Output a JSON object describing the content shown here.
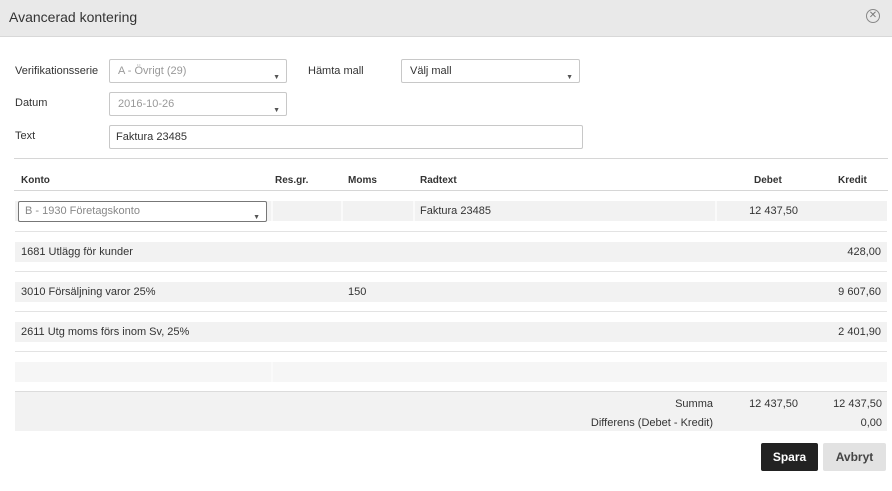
{
  "dialog": {
    "title": "Avancerad kontering",
    "close_icon": "close-circle-icon"
  },
  "form": {
    "series_label": "Verifikationsserie",
    "series_value": "A - Övrigt (29)",
    "template_label": "Hämta mall",
    "template_value": "Välj mall",
    "date_label": "Datum",
    "date_value": "2016-10-26",
    "text_label": "Text",
    "text_value": "Faktura 23485"
  },
  "table": {
    "headers": {
      "konto": "Konto",
      "resgr": "Res.gr.",
      "moms": "Moms",
      "radtext": "Radtext",
      "debet": "Debet",
      "kredit": "Kredit"
    },
    "rows": [
      {
        "konto": "B - 1930 Företagskonto",
        "resgr": "",
        "moms": "",
        "radtext": "Faktura 23485",
        "debet": "12 437,50",
        "kredit": ""
      },
      {
        "konto": "1681 Utlägg för kunder",
        "resgr": "",
        "moms": "",
        "radtext": "",
        "debet": "",
        "kredit": "428,00"
      },
      {
        "konto": "3010 Försäljning varor 25%",
        "resgr": "",
        "moms": "150",
        "radtext": "",
        "debet": "",
        "kredit": "9 607,60"
      },
      {
        "konto": "2611 Utg moms förs inom Sv, 25%",
        "resgr": "",
        "moms": "",
        "radtext": "",
        "debet": "",
        "kredit": "2 401,90"
      }
    ]
  },
  "summary": {
    "sum_label": "Summa",
    "sum_debet": "12 437,50",
    "sum_kredit": "12 437,50",
    "diff_label": "Differens (Debet - Kredit)",
    "diff_value": "0,00"
  },
  "buttons": {
    "save": "Spara",
    "cancel": "Avbryt"
  }
}
